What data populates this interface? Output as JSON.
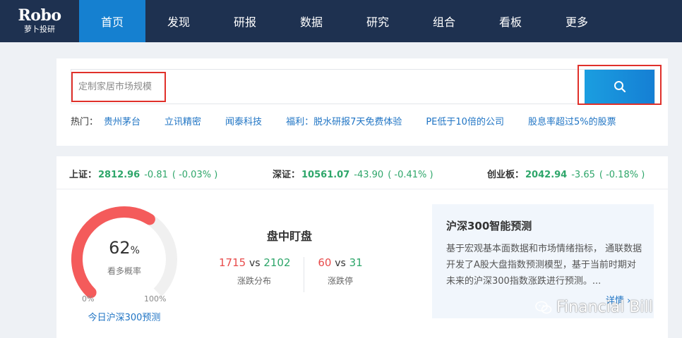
{
  "brand": {
    "logo_main": "Robo",
    "logo_sub": "萝卜投研"
  },
  "nav": {
    "items": [
      {
        "label": "首页",
        "active": true
      },
      {
        "label": "发现"
      },
      {
        "label": "研报"
      },
      {
        "label": "数据"
      },
      {
        "label": "研究"
      },
      {
        "label": "组合"
      },
      {
        "label": "看板"
      },
      {
        "label": "更多"
      }
    ]
  },
  "search": {
    "placeholder": "定制家居市场规模",
    "button_icon": "search-icon",
    "hot_label": "热门：",
    "hot_links": [
      "贵州茅台",
      "立讯精密",
      "闻泰科技",
      "福利：脱水研报7天免费体验",
      "PE低于10倍的公司",
      "股息率超过5%的股票"
    ]
  },
  "indices": [
    {
      "name": "上证：",
      "value": "2812.96",
      "change": "-0.81",
      "pct": "( -0.03% )"
    },
    {
      "name": "深证：",
      "value": "10561.07",
      "change": "-43.90",
      "pct": "( -0.41% )"
    },
    {
      "name": "创业板：",
      "value": "2042.94",
      "change": "-3.65",
      "pct": "( -0.18% )"
    }
  ],
  "gauge": {
    "value": "62",
    "unit": "%",
    "level": 0.62,
    "label": "看多概率",
    "min_label": "0%",
    "max_label": "100%",
    "link": "今日沪深300预测"
  },
  "panel": {
    "title": "盘中盯盘",
    "stats": [
      {
        "up": "1715",
        "vs": "vs",
        "down": "2102",
        "label": "涨跌分布"
      },
      {
        "up": "60",
        "vs": "vs",
        "down": "31",
        "label": "涨跌停"
      }
    ]
  },
  "predict": {
    "title": "沪深300智能预测",
    "text": "基于宏观基本面数据和市场情绪指标， 通联数据开发了A股大盘指数预测模型，基于当前时期对未来的沪深300指数涨跌进行预测。...",
    "more": "详情"
  },
  "watermark": {
    "text": "Financial Bill"
  },
  "colors": {
    "nav_bg": "#1e3150",
    "nav_active": "#1580d0",
    "link": "#1f74c4",
    "up": "#e84b4b",
    "down": "#2ea66a",
    "highlight": "#e0302a"
  }
}
